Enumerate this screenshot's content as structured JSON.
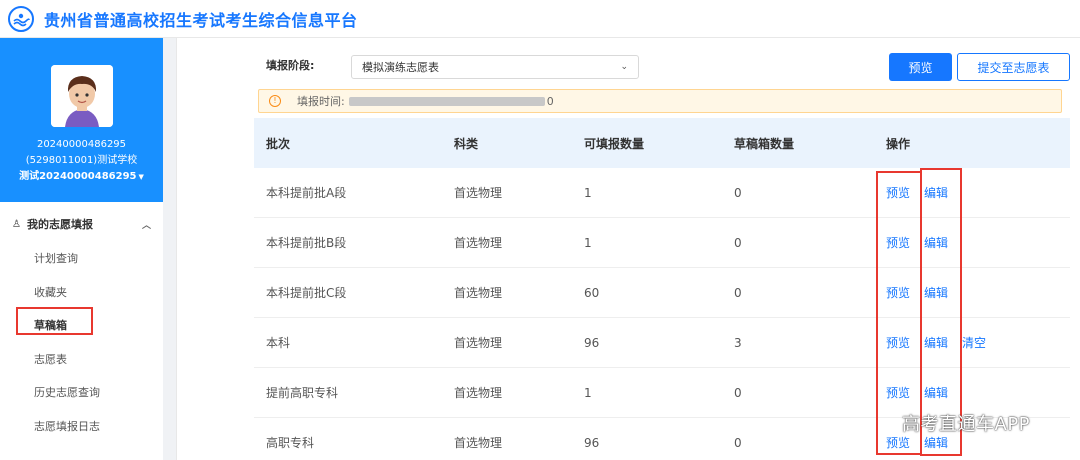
{
  "header": {
    "title": "贵州省普通高校招生考试考生综合信息平台",
    "logo_icon": "platform-logo-icon"
  },
  "profile": {
    "id": "20240000486295",
    "school": "(5298011001)测试学校",
    "name": "测试20240000486295"
  },
  "sidebar": {
    "group_label": "我的志愿填报",
    "items": [
      "计划查询",
      "收藏夹",
      "草稿箱",
      "志愿表",
      "历史志愿查询",
      "志愿填报日志"
    ],
    "active": "草稿箱"
  },
  "toolbar": {
    "stage_label": "填报阶段:",
    "stage_value": "模拟演练志愿表",
    "preview_label": "预览",
    "submit_label": "提交至志愿表"
  },
  "notice": {
    "prefix": "填报时间:",
    "suffix": "0"
  },
  "table": {
    "headers": [
      "批次",
      "科类",
      "可填报数量",
      "草稿箱数量",
      "操作"
    ],
    "rows": [
      {
        "batch": "本科提前批A段",
        "category": "首选物理",
        "quota": "1",
        "draft": "0",
        "ops": [
          "预览",
          "编辑"
        ]
      },
      {
        "batch": "本科提前批B段",
        "category": "首选物理",
        "quota": "1",
        "draft": "0",
        "ops": [
          "预览",
          "编辑"
        ]
      },
      {
        "batch": "本科提前批C段",
        "category": "首选物理",
        "quota": "60",
        "draft": "0",
        "ops": [
          "预览",
          "编辑"
        ]
      },
      {
        "batch": "本科",
        "category": "首选物理",
        "quota": "96",
        "draft": "3",
        "ops": [
          "预览",
          "编辑",
          "清空"
        ]
      },
      {
        "batch": "提前高职专科",
        "category": "首选物理",
        "quota": "1",
        "draft": "0",
        "ops": [
          "预览",
          "编辑"
        ]
      },
      {
        "batch": "高职专科",
        "category": "首选物理",
        "quota": "96",
        "draft": "0",
        "ops": [
          "预览",
          "编辑"
        ]
      }
    ]
  },
  "watermark": "高考直通车APP",
  "colors": {
    "primary": "#1677ff",
    "sidebar_profile": "#1890ff",
    "highlight": "#e8382f",
    "notice_bg": "#fff7e6"
  }
}
